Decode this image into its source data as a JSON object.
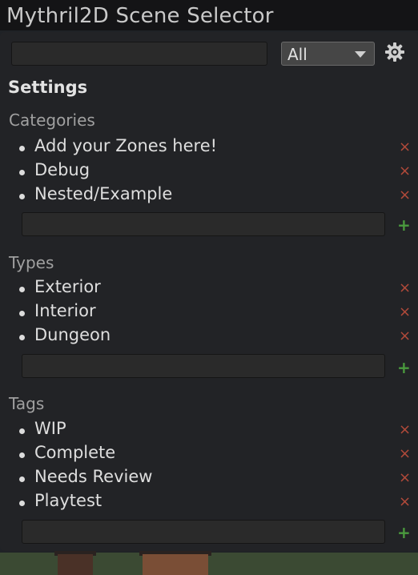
{
  "window": {
    "title": "Mythril2D Scene Selector"
  },
  "toolbar": {
    "search_value": "",
    "filter_selected": "All"
  },
  "settings": {
    "heading": "Settings",
    "remove_glyph": "×",
    "add_glyph": "+",
    "sections": [
      {
        "label": "Categories",
        "items": [
          "Add your Zones here!",
          "Debug",
          "Nested/Example"
        ]
      },
      {
        "label": "Types",
        "items": [
          "Exterior",
          "Interior",
          "Dungeon"
        ]
      },
      {
        "label": "Tags",
        "items": [
          "WIP",
          "Complete",
          "Needs Review",
          "Playtest"
        ]
      }
    ]
  },
  "colors": {
    "panel_bg": "#222326",
    "remove": "#b24a3a",
    "add": "#4a9a3e"
  }
}
